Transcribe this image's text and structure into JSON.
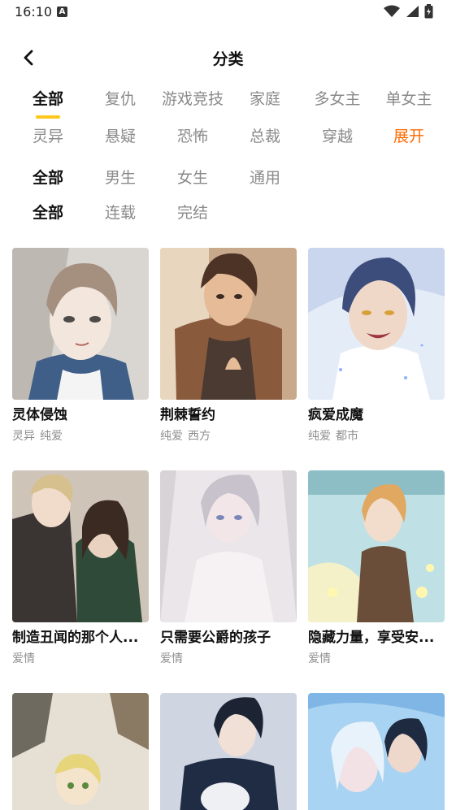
{
  "status_bar": {
    "time": "16:10",
    "notification_icon": "a-icon",
    "icons": [
      "wifi-icon",
      "signal-icon",
      "battery-icon"
    ]
  },
  "header": {
    "title": "分类",
    "back_icon": "chevron-left-icon"
  },
  "filters": {
    "genre_row1": [
      "全部",
      "复仇",
      "游戏竞技",
      "家庭",
      "多女主",
      "单女主"
    ],
    "genre_row2": [
      "灵异",
      "悬疑",
      "恐怖",
      "总裁",
      "穿越",
      "展开"
    ],
    "audience": [
      "全部",
      "男生",
      "女生",
      "通用"
    ],
    "status": [
      "全部",
      "连载",
      "完结"
    ],
    "active_color": "#111111",
    "inactive_color": "#8a8a8a",
    "expand_color": "#ff6a00",
    "indicator_color": "#ffc61c"
  },
  "comics": [
    {
      "title": "灵体侵蚀",
      "tags": [
        "灵异",
        "纯爱"
      ]
    },
    {
      "title": "荆棘誓约",
      "tags": [
        "纯爱",
        "西方"
      ]
    },
    {
      "title": "疯爱成魔",
      "tags": [
        "纯爱",
        "都市"
      ]
    },
    {
      "title": "制造丑闻的那个人...",
      "tags": [
        "爱情"
      ]
    },
    {
      "title": "只需要公爵的孩子",
      "tags": [
        "爱情"
      ]
    },
    {
      "title": "隐藏力量，享受安...",
      "tags": [
        "爱情"
      ]
    },
    {
      "title": "",
      "tags": []
    },
    {
      "title": "",
      "tags": []
    },
    {
      "title": "",
      "tags": []
    }
  ]
}
